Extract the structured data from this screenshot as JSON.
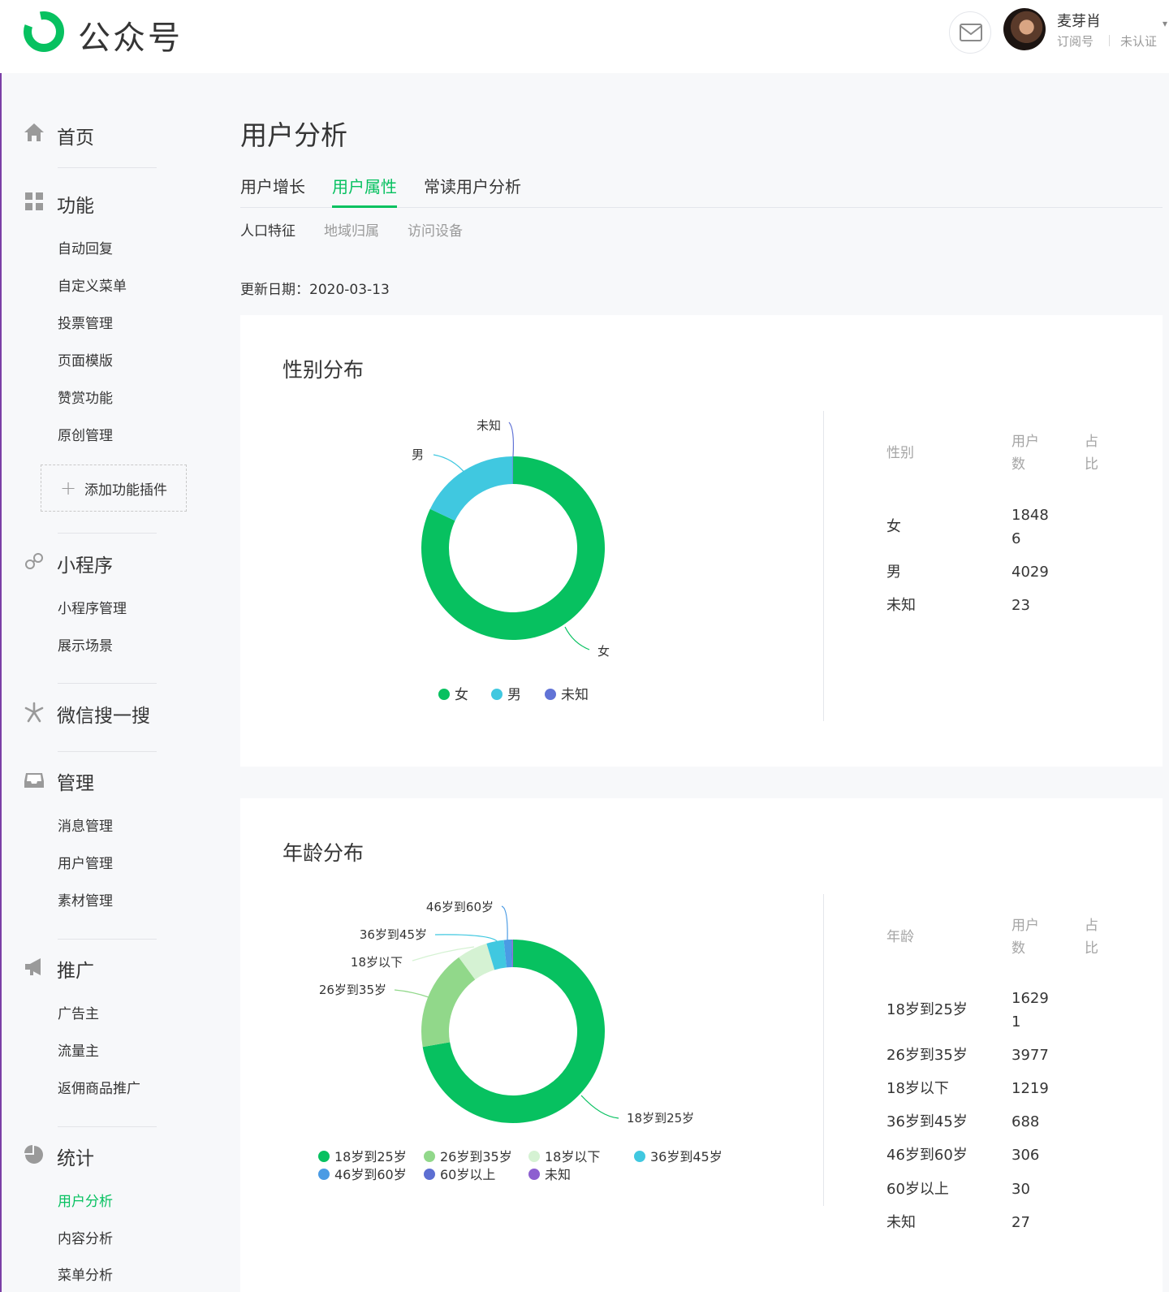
{
  "header": {
    "logo_text": "公众号",
    "account": {
      "name": "麦芽肖",
      "type": "订阅号",
      "verify": "未认证"
    }
  },
  "sidebar": {
    "home": "首页",
    "functions": {
      "title": "功能",
      "items": [
        "自动回复",
        "自定义菜单",
        "投票管理",
        "页面模版",
        "赞赏功能",
        "原创管理"
      ],
      "add_plugin": "添加功能插件"
    },
    "miniprogram": {
      "title": "小程序",
      "items": [
        "小程序管理",
        "展示场景"
      ]
    },
    "search": {
      "title": "微信搜一搜"
    },
    "manage": {
      "title": "管理",
      "items": [
        "消息管理",
        "用户管理",
        "素材管理"
      ]
    },
    "promote": {
      "title": "推广",
      "items": [
        "广告主",
        "流量主",
        "返佣商品推广"
      ]
    },
    "stats": {
      "title": "统计",
      "items": [
        "用户分析",
        "内容分析",
        "菜单分析"
      ],
      "active": "用户分析"
    }
  },
  "main": {
    "title": "用户分析",
    "tabs": [
      "用户增长",
      "用户属性",
      "常读用户分析"
    ],
    "active_tab": "用户属性",
    "subtabs": [
      "人口特征",
      "地域归属",
      "访问设备"
    ],
    "active_subtab": "人口特征",
    "update_label": "更新日期：",
    "update_date": "2020-03-13"
  },
  "colors": {
    "accent": "#07c160",
    "female": "#07c160",
    "male": "#40c8e0",
    "unknown": "#6173d6"
  },
  "chart_data": [
    {
      "type": "pie",
      "title": "性别分布",
      "donut": true,
      "categories": [
        "女",
        "男",
        "未知"
      ],
      "values": [
        18486,
        4029,
        23
      ],
      "colors": [
        "#07c160",
        "#40c8e0",
        "#6173d6"
      ],
      "legend": "bottom",
      "table": {
        "headers": [
          "性别",
          "用户数",
          "占比"
        ],
        "rows": [
          [
            "女",
            "18486"
          ],
          [
            "男",
            "4029"
          ],
          [
            "未知",
            "23"
          ]
        ]
      }
    },
    {
      "type": "pie",
      "title": "年龄分布",
      "donut": true,
      "categories": [
        "18岁到25岁",
        "26岁到35岁",
        "18岁以下",
        "36岁到45岁",
        "46岁到60岁",
        "60岁以上",
        "未知"
      ],
      "values": [
        16291,
        3977,
        1219,
        688,
        306,
        30,
        27
      ],
      "colors": [
        "#07c160",
        "#91d88a",
        "#d5f2d3",
        "#40c8e0",
        "#4a9be4",
        "#5d6fd2",
        "#8d5fd0"
      ],
      "legend": "bottom",
      "table": {
        "headers": [
          "年龄",
          "用户数",
          "占比"
        ],
        "rows": [
          [
            "18岁到25岁",
            "16291"
          ],
          [
            "26岁到35岁",
            "3977"
          ],
          [
            "18岁以下",
            "1219"
          ],
          [
            "36岁到45岁",
            "688"
          ],
          [
            "46岁到60岁",
            "306"
          ],
          [
            "60岁以上",
            "30"
          ],
          [
            "未知",
            "27"
          ]
        ]
      }
    }
  ]
}
